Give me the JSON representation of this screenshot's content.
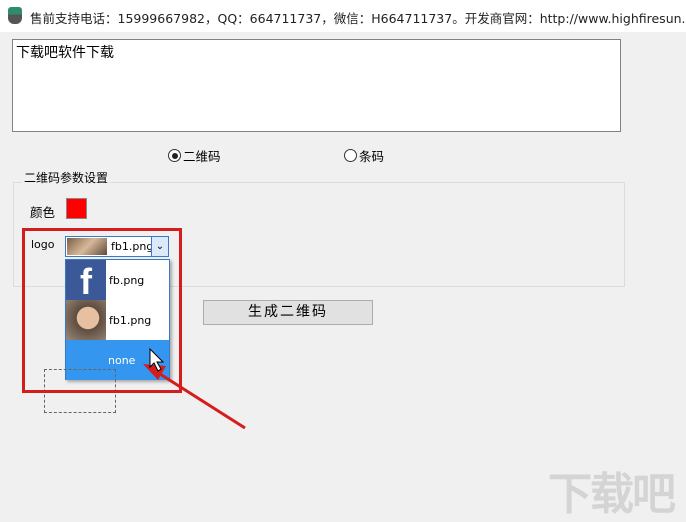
{
  "window": {
    "title": "售前支持电话：15999667982，QQ：664711737，微信：H664711737。开发商官网：http://www.highfiresun.com"
  },
  "input": {
    "value": "下载吧软件下载"
  },
  "mode": {
    "options": [
      "二维码",
      "条码"
    ],
    "selected": "二维码"
  },
  "qr_settings": {
    "group_title": "二维码参数设置",
    "color_label": "颜色",
    "color_value": "#ff0000",
    "logo_label": "logo",
    "logo_selected": "fb1.png",
    "logo_options": [
      "fb.png",
      "fb1.png",
      "none"
    ],
    "highlighted_option": "none"
  },
  "generate_button": "生成二维码",
  "watermark": "下载吧"
}
